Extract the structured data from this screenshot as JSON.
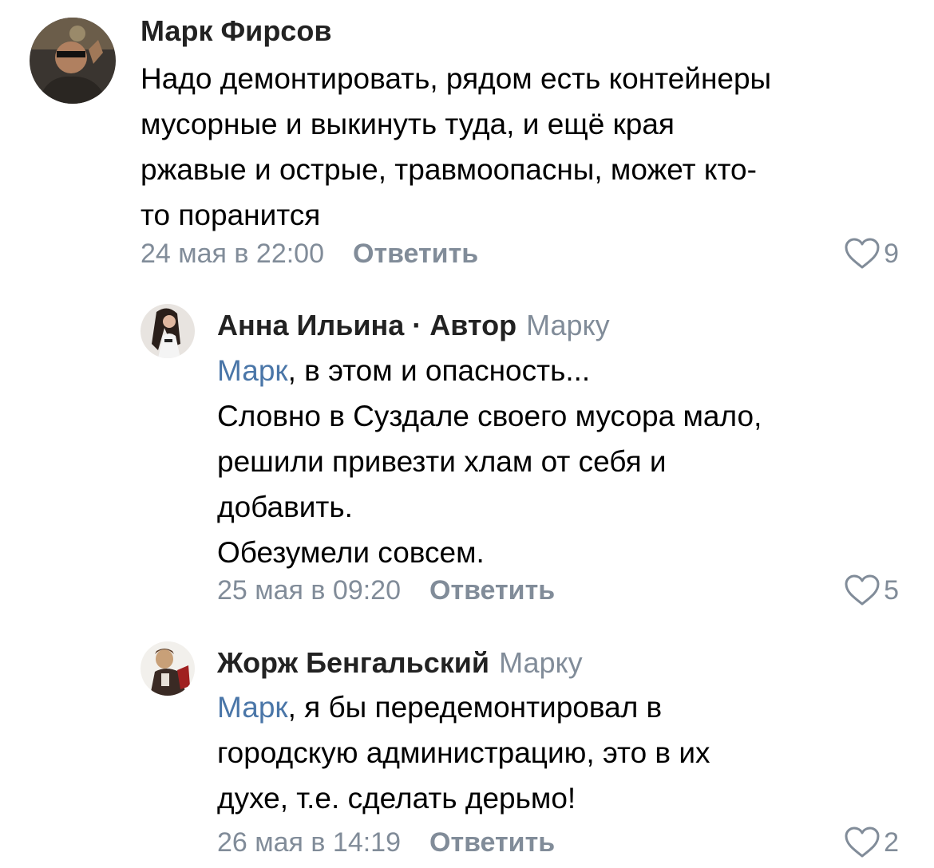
{
  "comments": [
    {
      "author": "Марк Фирсов",
      "text_lines": [
        "Надо демонтировать, рядом есть контейнеры",
        "мусорные и выкинуть туда, и ещё края",
        "ржавые и острые, травмоопасны, может кто-",
        "то поранится"
      ],
      "date": "24 мая в 22:00",
      "reply_label": "Ответить",
      "likes": "9"
    },
    {
      "author": "Анна Ильина",
      "author_tag": " · Автор",
      "reply_to": "Марку",
      "mention": "Марк",
      "text_first_rest": ", в этом и опасность...",
      "text_lines": [
        "Словно в Суздале своего мусора мало,",
        "решили привезти хлам от себя и",
        "добавить.",
        "Обезумели совсем."
      ],
      "date": "25 мая в 09:20",
      "reply_label": "Ответить",
      "likes": "5"
    },
    {
      "author": "Жорж Бенгальский",
      "reply_to": "Марку",
      "mention": "Марк",
      "text_first_rest": ", я бы передемонтировал в",
      "text_lines": [
        "городскую администрацию, это в их",
        "духе, т.е. сделать дерьмо!"
      ],
      "date": "26 мая в 14:19",
      "reply_label": "Ответить",
      "likes": "2"
    }
  ],
  "colors": {
    "secondary": "#818c99",
    "link": "#4a76a8",
    "text": "#000000"
  },
  "icons": {
    "like": "heart-outline-icon"
  }
}
